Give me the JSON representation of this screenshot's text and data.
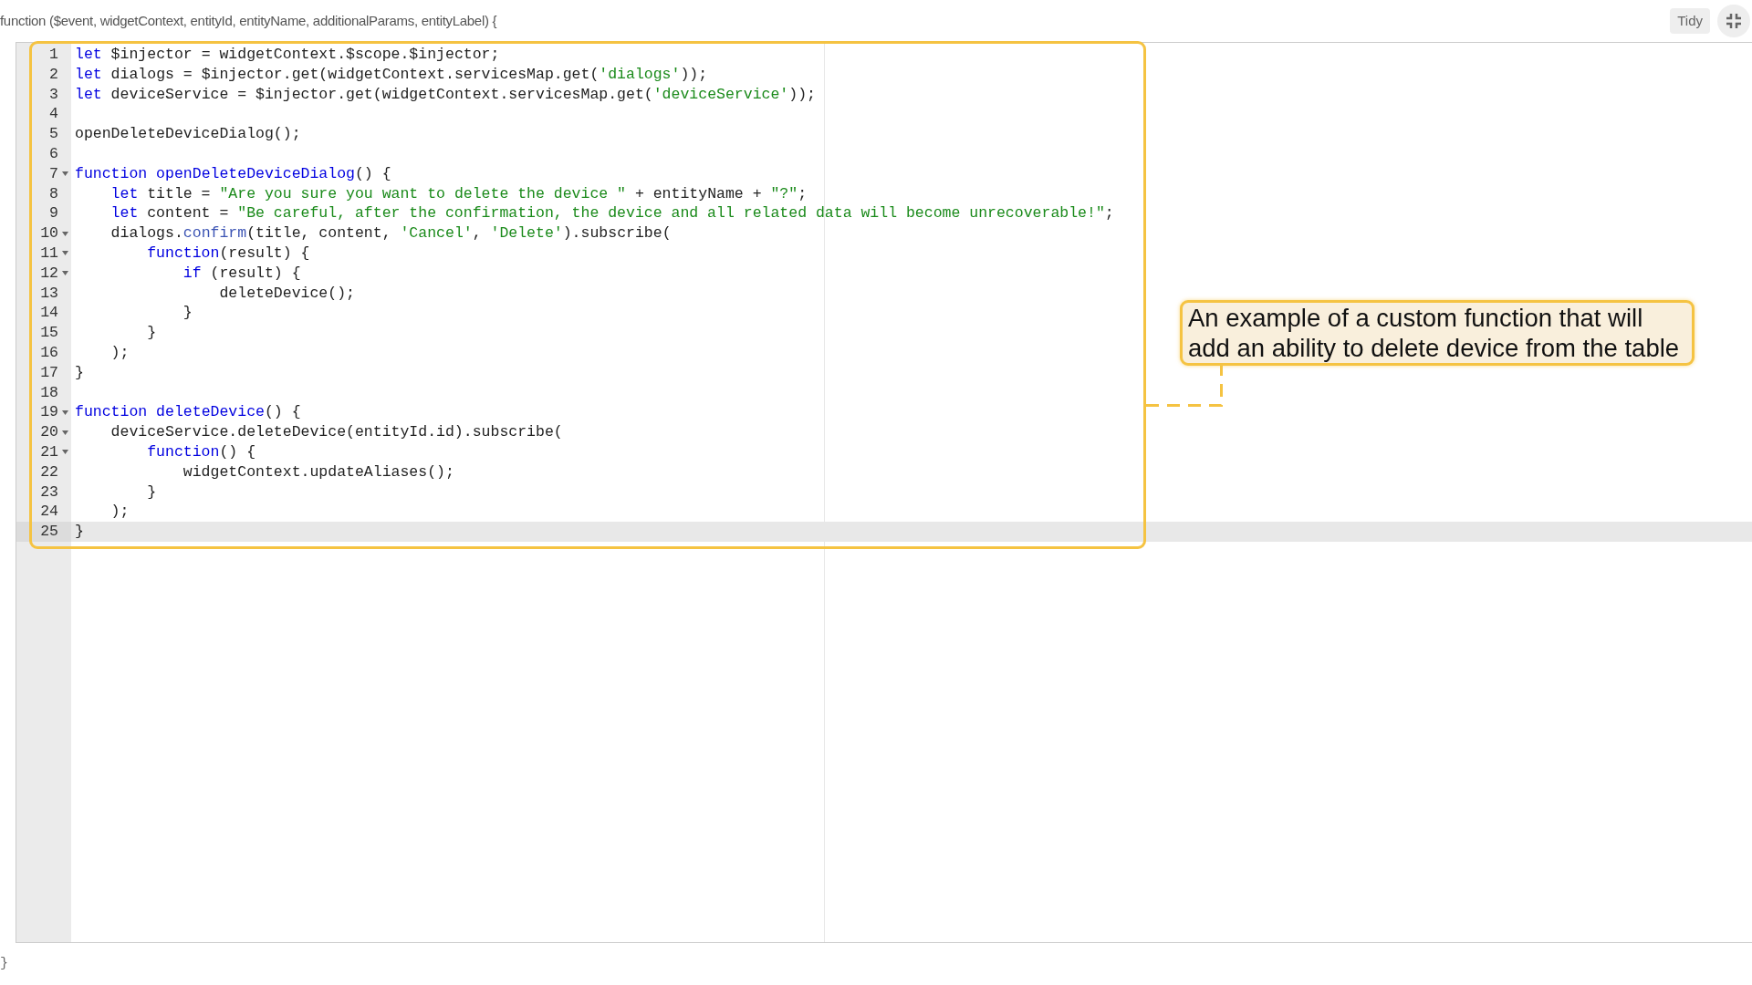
{
  "header": {
    "signature": "function ($event, widgetContext, entityId, entityName, additionalParams, entityLabel) {",
    "tidy_button": "Tidy"
  },
  "editor": {
    "lines": [
      {
        "number": "1",
        "fold": false,
        "active": false,
        "tokens": [
          {
            "kind": "keyword",
            "text": "let"
          },
          {
            "kind": "plain",
            "text": " $injector = widgetContext.$scope.$injector;"
          }
        ]
      },
      {
        "number": "2",
        "fold": false,
        "active": false,
        "tokens": [
          {
            "kind": "keyword",
            "text": "let"
          },
          {
            "kind": "plain",
            "text": " dialogs = $injector.get(widgetContext.servicesMap.get("
          },
          {
            "kind": "string",
            "text": "'dialogs'"
          },
          {
            "kind": "plain",
            "text": "));"
          }
        ]
      },
      {
        "number": "3",
        "fold": false,
        "active": false,
        "tokens": [
          {
            "kind": "keyword",
            "text": "let"
          },
          {
            "kind": "plain",
            "text": " deviceService = $injector.get(widgetContext.servicesMap.get("
          },
          {
            "kind": "string",
            "text": "'deviceService'"
          },
          {
            "kind": "plain",
            "text": "));"
          }
        ]
      },
      {
        "number": "4",
        "fold": false,
        "active": false
      },
      {
        "number": "5",
        "fold": false,
        "active": false,
        "tokens": [
          {
            "kind": "plain",
            "text": "openDeleteDeviceDialog();"
          }
        ]
      },
      {
        "number": "6",
        "fold": false,
        "active": false
      },
      {
        "number": "7",
        "fold": true,
        "active": false,
        "tokens": [
          {
            "kind": "keyword",
            "text": "function"
          },
          {
            "kind": "keyword",
            "text": " openDeleteDeviceDialog"
          },
          {
            "kind": "plain",
            "text": "() {"
          }
        ]
      },
      {
        "number": "8",
        "fold": false,
        "active": false,
        "tokens": [
          {
            "kind": "keyword",
            "text": "    let"
          },
          {
            "kind": "plain",
            "text": " title = "
          },
          {
            "kind": "string",
            "text": "\"Are you sure you want to delete the device \""
          },
          {
            "kind": "plain",
            "text": " + entityName + "
          },
          {
            "kind": "string",
            "text": "\"?\""
          },
          {
            "kind": "plain",
            "text": ";"
          }
        ]
      },
      {
        "number": "9",
        "fold": false,
        "active": false,
        "tokens": [
          {
            "kind": "keyword",
            "text": "    let"
          },
          {
            "kind": "plain",
            "text": " content = "
          },
          {
            "kind": "string",
            "text": "\"Be careful, after the confirmation, the device and all related data will become unrecoverable!\""
          },
          {
            "kind": "plain",
            "text": ";"
          }
        ]
      },
      {
        "number": "10",
        "fold": true,
        "active": false,
        "tokens": [
          {
            "kind": "plain",
            "text": "    dialogs."
          },
          {
            "kind": "method",
            "text": "confirm"
          },
          {
            "kind": "plain",
            "text": "(title, content, "
          },
          {
            "kind": "string",
            "text": "'Cancel'"
          },
          {
            "kind": "plain",
            "text": ", "
          },
          {
            "kind": "string",
            "text": "'Delete'"
          },
          {
            "kind": "plain",
            "text": ").subscribe("
          }
        ]
      },
      {
        "number": "11",
        "fold": true,
        "active": false,
        "tokens": [
          {
            "kind": "keyword",
            "text": "        function"
          },
          {
            "kind": "plain",
            "text": "(result) {"
          }
        ]
      },
      {
        "number": "12",
        "fold": true,
        "active": false,
        "tokens": [
          {
            "kind": "keyword",
            "text": "            if"
          },
          {
            "kind": "plain",
            "text": " (result) {"
          }
        ]
      },
      {
        "number": "13",
        "fold": false,
        "active": false,
        "tokens": [
          {
            "kind": "plain",
            "text": "                deleteDevice();"
          }
        ]
      },
      {
        "number": "14",
        "fold": false,
        "active": false,
        "tokens": [
          {
            "kind": "plain",
            "text": "            }"
          }
        ]
      },
      {
        "number": "15",
        "fold": false,
        "active": false,
        "tokens": [
          {
            "kind": "plain",
            "text": "        }"
          }
        ]
      },
      {
        "number": "16",
        "fold": false,
        "active": false,
        "tokens": [
          {
            "kind": "plain",
            "text": "    );"
          }
        ]
      },
      {
        "number": "17",
        "fold": false,
        "active": false,
        "tokens": [
          {
            "kind": "plain",
            "text": "}"
          }
        ]
      },
      {
        "number": "18",
        "fold": false,
        "active": false
      },
      {
        "number": "19",
        "fold": true,
        "active": false,
        "tokens": [
          {
            "kind": "keyword",
            "text": "function"
          },
          {
            "kind": "keyword",
            "text": " deleteDevice"
          },
          {
            "kind": "plain",
            "text": "() {"
          }
        ]
      },
      {
        "number": "20",
        "fold": true,
        "active": false,
        "tokens": [
          {
            "kind": "plain",
            "text": "    deviceService.deleteDevice(entityId.id).subscribe("
          }
        ]
      },
      {
        "number": "21",
        "fold": true,
        "active": false,
        "tokens": [
          {
            "kind": "keyword",
            "text": "        function"
          },
          {
            "kind": "plain",
            "text": "() {"
          }
        ]
      },
      {
        "number": "22",
        "fold": false,
        "active": false,
        "tokens": [
          {
            "kind": "plain",
            "text": "            widgetContext.updateAliases();"
          }
        ]
      },
      {
        "number": "23",
        "fold": false,
        "active": false,
        "tokens": [
          {
            "kind": "plain",
            "text": "        }"
          }
        ]
      },
      {
        "number": "24",
        "fold": false,
        "active": false,
        "tokens": [
          {
            "kind": "plain",
            "text": "    );"
          }
        ]
      },
      {
        "number": "25",
        "fold": false,
        "active": true,
        "tokens": [
          {
            "kind": "plain",
            "text": "}"
          }
        ]
      }
    ]
  },
  "callout": {
    "text": "An example of a custom function that will add an ability to delete device from the table"
  },
  "footer": {
    "closing": "}"
  }
}
